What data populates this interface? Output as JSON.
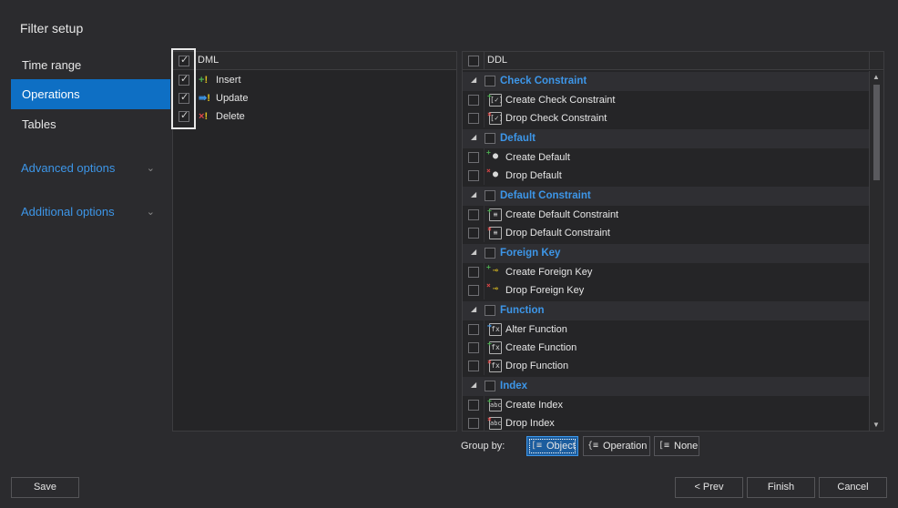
{
  "dialog": {
    "title": "Filter setup"
  },
  "nav": {
    "items": [
      {
        "label": "Time range"
      },
      {
        "label": "Operations"
      },
      {
        "label": "Tables"
      }
    ],
    "expanders": [
      {
        "label": "Advanced options"
      },
      {
        "label": "Additional options"
      }
    ],
    "active": "Operations"
  },
  "dml": {
    "header": "DML",
    "all_checked": true,
    "items": [
      {
        "label": "Insert",
        "checked": true,
        "icon": "insert-icon"
      },
      {
        "label": "Update",
        "checked": true,
        "icon": "update-icon"
      },
      {
        "label": "Delete",
        "checked": true,
        "icon": "delete-icon"
      }
    ]
  },
  "ddl": {
    "header": "DDL",
    "groups": [
      {
        "label": "Check Constraint",
        "items": [
          {
            "label": "Create Check Constraint"
          },
          {
            "label": "Drop Check Constraint"
          }
        ]
      },
      {
        "label": "Default",
        "items": [
          {
            "label": "Create Default"
          },
          {
            "label": "Drop Default"
          }
        ]
      },
      {
        "label": "Default Constraint",
        "items": [
          {
            "label": "Create Default Constraint"
          },
          {
            "label": "Drop Default Constraint"
          }
        ]
      },
      {
        "label": "Foreign Key",
        "items": [
          {
            "label": "Create Foreign Key"
          },
          {
            "label": "Drop Foreign Key"
          }
        ]
      },
      {
        "label": "Function",
        "items": [
          {
            "label": "Alter Function"
          },
          {
            "label": "Create Function"
          },
          {
            "label": "Drop Function"
          }
        ]
      },
      {
        "label": "Index",
        "items": [
          {
            "label": "Create Index"
          },
          {
            "label": "Drop Index"
          }
        ]
      }
    ]
  },
  "group_by": {
    "label": "Group by:",
    "options": [
      {
        "label": "Object",
        "selected": true
      },
      {
        "label": "Operation",
        "selected": false
      },
      {
        "label": "None",
        "selected": false
      }
    ]
  },
  "footer": {
    "save": "Save",
    "prev": "< Prev",
    "finish": "Finish",
    "cancel": "Cancel"
  },
  "colors": {
    "accent": "#0e6fc4",
    "link": "#3d96e8",
    "background": "#2b2b2e"
  }
}
